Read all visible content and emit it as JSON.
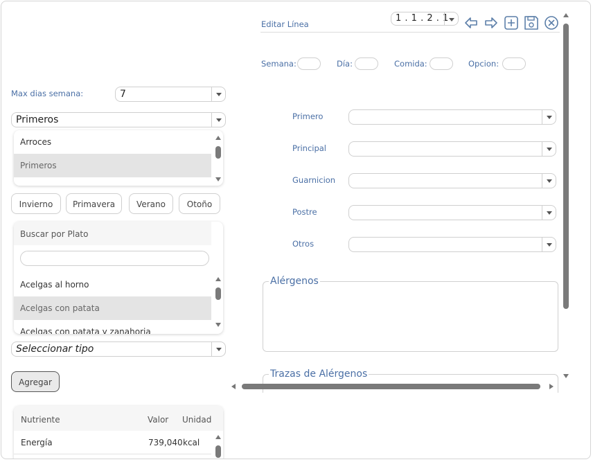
{
  "left": {
    "max_dias": {
      "label": "Max dias semana:",
      "value": "7"
    },
    "category_select": {
      "value": "Primeros"
    },
    "category_list": [
      "Arroces",
      "Primeros"
    ],
    "category_selected_index": 1,
    "seasons": [
      "Invierno",
      "Primavera",
      "Verano",
      "Otoño"
    ],
    "dish_search": {
      "header": "Buscar por Plato",
      "placeholder": "",
      "items": [
        "Acelgas al horno",
        "Acelgas con patata",
        "Acelgas con patata y zanahoria"
      ],
      "selected_index": 1
    },
    "type_select": {
      "value": "Seleccionar tipo"
    },
    "add_button": "Agregar",
    "nutrients": {
      "columns": [
        "Nutriente",
        "Valor",
        "Unidad"
      ],
      "rows": [
        {
          "name": "Energía",
          "value": "739,040",
          "unit": "kcal"
        }
      ]
    }
  },
  "right": {
    "title": "Editar Línea",
    "code_select": {
      "value": "1 . 1 . 2 . 1"
    },
    "toolbar_icons": [
      "arrow-left-icon",
      "arrow-right-icon",
      "add-icon",
      "save-icon",
      "close-icon"
    ],
    "position_fields": [
      {
        "label": "Semana:"
      },
      {
        "label": "Día:"
      },
      {
        "label": "Comida:"
      },
      {
        "label": "Opcion:"
      }
    ],
    "course_fields": [
      {
        "label": "Primero"
      },
      {
        "label": "Principal"
      },
      {
        "label": "Guarnicion"
      },
      {
        "label": "Postre"
      },
      {
        "label": "Otros"
      }
    ],
    "allergens": {
      "legend": "Alérgenos"
    },
    "traces": {
      "legend": "Trazas de Alérgenos"
    }
  },
  "colors": {
    "accent": "#4a6fa5",
    "selected_row": "#e4e4e4",
    "scroll_thumb": "#7a7a7a",
    "icon": "#5b7ea8"
  }
}
